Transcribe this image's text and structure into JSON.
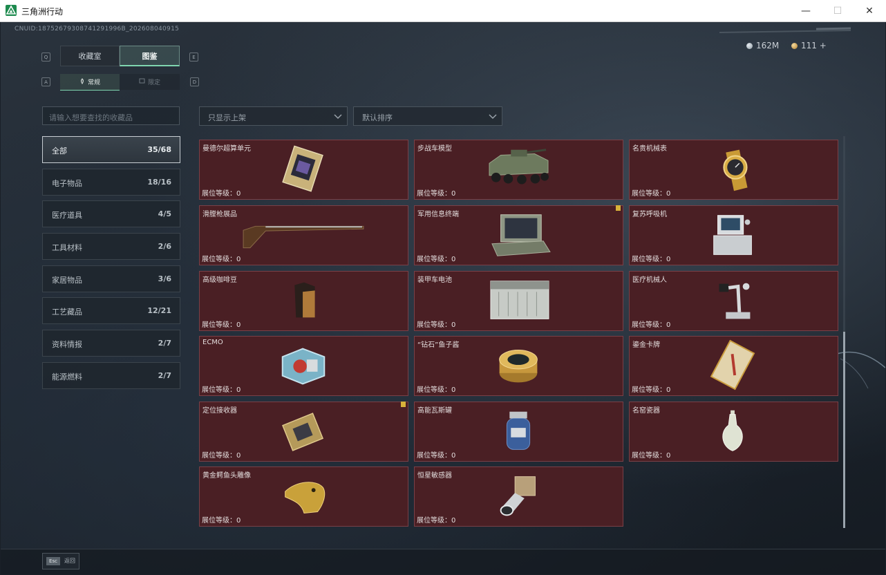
{
  "window": {
    "title": "三角洲行动",
    "minimize": "—",
    "maximize": "☐",
    "close": "✕"
  },
  "header": {
    "uid": "CNUID:18752679308741291996B_202608040915",
    "currency1": "162M",
    "currency2": "111 +"
  },
  "keys": {
    "left_top": "Q",
    "right_top": "E",
    "left_sub": "A",
    "right_sub": "D"
  },
  "tabs": [
    "收藏室",
    "图鉴"
  ],
  "subtabs": [
    "常规",
    "限定"
  ],
  "search": {
    "placeholder": "请输入想要查找的收藏品"
  },
  "filters": {
    "shelf": "只显示上架",
    "sort": "默认排序"
  },
  "categories": [
    {
      "name": "全部",
      "count": "35/68"
    },
    {
      "name": "电子物品",
      "count": "18/16"
    },
    {
      "name": "医疗道具",
      "count": "4/5"
    },
    {
      "name": "工具材料",
      "count": "2/6"
    },
    {
      "name": "家居物品",
      "count": "3/6"
    },
    {
      "name": "工艺藏品",
      "count": "12/21"
    },
    {
      "name": "资料情报",
      "count": "2/7"
    },
    {
      "name": "能源燃料",
      "count": "2/7"
    }
  ],
  "items": [
    {
      "name": "曼德尔超算单元",
      "level": "展位等级：0",
      "icon": "supercomputer-unit-icon"
    },
    {
      "name": "步战车模型",
      "level": "展位等级：0",
      "icon": "ifv-model-icon"
    },
    {
      "name": "名贵机械表",
      "level": "展位等级：0",
      "icon": "luxury-watch-icon"
    },
    {
      "name": "滑膛枪展品",
      "level": "展位等级：0",
      "icon": "musket-icon"
    },
    {
      "name": "军用信息终端",
      "level": "展位等级：0",
      "icon": "military-terminal-icon"
    },
    {
      "name": "复苏呼吸机",
      "level": "展位等级：0",
      "icon": "ventilator-icon"
    },
    {
      "name": "高级咖啡豆",
      "level": "展位等级：0",
      "icon": "coffee-bag-icon"
    },
    {
      "name": "装甲车电池",
      "level": "展位等级：0",
      "icon": "vehicle-battery-icon"
    },
    {
      "name": "医疗机械人",
      "level": "展位等级：0",
      "icon": "medical-robot-icon"
    },
    {
      "name": "ECMO",
      "level": "展位等级：0",
      "icon": "ecmo-icon"
    },
    {
      "name": "“钻石”鱼子酱",
      "level": "展位等级：0",
      "icon": "caviar-tin-icon"
    },
    {
      "name": "鎏金卡牌",
      "level": "展位等级：0",
      "icon": "gilded-card-icon"
    },
    {
      "name": "定位接收器",
      "level": "展位等级：0",
      "icon": "gps-receiver-icon"
    },
    {
      "name": "高能瓦斯罐",
      "level": "展位等级：0",
      "icon": "gas-canister-icon"
    },
    {
      "name": "名窑瓷器",
      "level": "展位等级：0",
      "icon": "porcelain-vase-icon"
    },
    {
      "name": "黄金鳄鱼头雕像",
      "level": "展位等级：0",
      "icon": "gold-crocodile-icon"
    },
    {
      "name": "恒星敏感器",
      "level": "展位等级：0",
      "icon": "star-sensor-icon"
    }
  ],
  "footer": {
    "esc_key": "Esc",
    "back": "返回"
  },
  "colors": {
    "card_bg": "#4a1f24",
    "card_border": "#7a4047",
    "accent": "#7fd6b0",
    "badge": "#d8b23a"
  }
}
